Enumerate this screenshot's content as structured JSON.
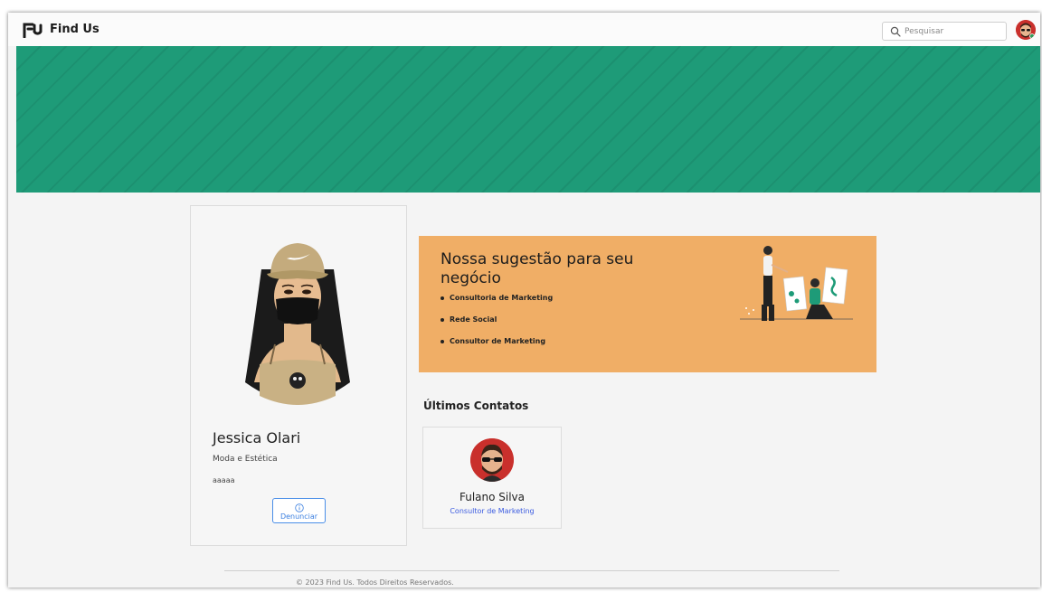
{
  "navbar": {
    "brand": "Find Us",
    "logo_icon": "find-us-logo-icon",
    "search": {
      "placeholder": "Pesquisar",
      "icon": "search-icon"
    },
    "user_avatar": "user-avatar"
  },
  "banner": {
    "color": "#1e9b78"
  },
  "profile": {
    "name": "Jessica Olari",
    "category": "Moda e Estética",
    "bio": "aaaaa",
    "report_label": "Denunciar",
    "report_icon": "info-icon"
  },
  "suggestion": {
    "title": "Nossa sugestão para seu negócio",
    "items": [
      "Consultoria de Marketing",
      "Rede Social",
      "Consultor de Marketing"
    ],
    "background": "#f0ae66"
  },
  "contacts": {
    "title": "Últimos Contatos",
    "items": [
      {
        "name": "Fulano Silva",
        "role": "Consultor de Marketing"
      }
    ]
  },
  "footer": {
    "text": "© 2023 Find Us. Todos Direitos Reservados."
  }
}
